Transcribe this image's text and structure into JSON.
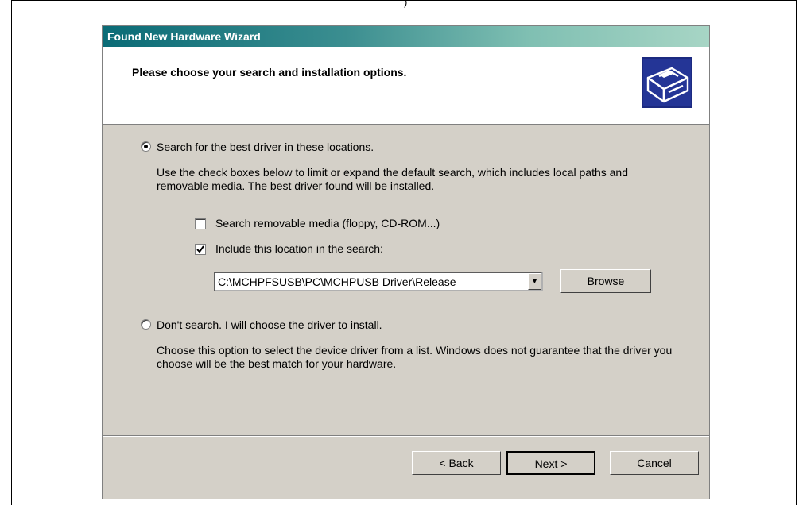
{
  "top_mark": ")",
  "dialog": {
    "title": "Found New Hardware Wizard",
    "header": "Please choose your search and installation options.",
    "icon": "hardware-device-icon"
  },
  "option_search": {
    "label": "Search for the best driver in these locations.",
    "selected": true,
    "description": "Use the check boxes below to limit or expand the default search, which includes local paths and removable media. The best driver found will be installed.",
    "removable_media": {
      "label": "Search removable media (floppy, CD-ROM...)",
      "checked": false
    },
    "include_location": {
      "label": "Include this location in the search:",
      "checked": true
    },
    "location_value": "C:\\MCHPFSUSB\\PC\\MCHPUSB Driver\\Release",
    "browse_label": "Browse"
  },
  "option_dont_search": {
    "label": "Don't search. I will choose the driver to install.",
    "selected": false,
    "description": "Choose this option to select the device driver from a list.  Windows does not guarantee that the driver you choose will be the best match for your hardware."
  },
  "buttons": {
    "back": "< Back",
    "next": "Next >",
    "cancel": "Cancel"
  }
}
